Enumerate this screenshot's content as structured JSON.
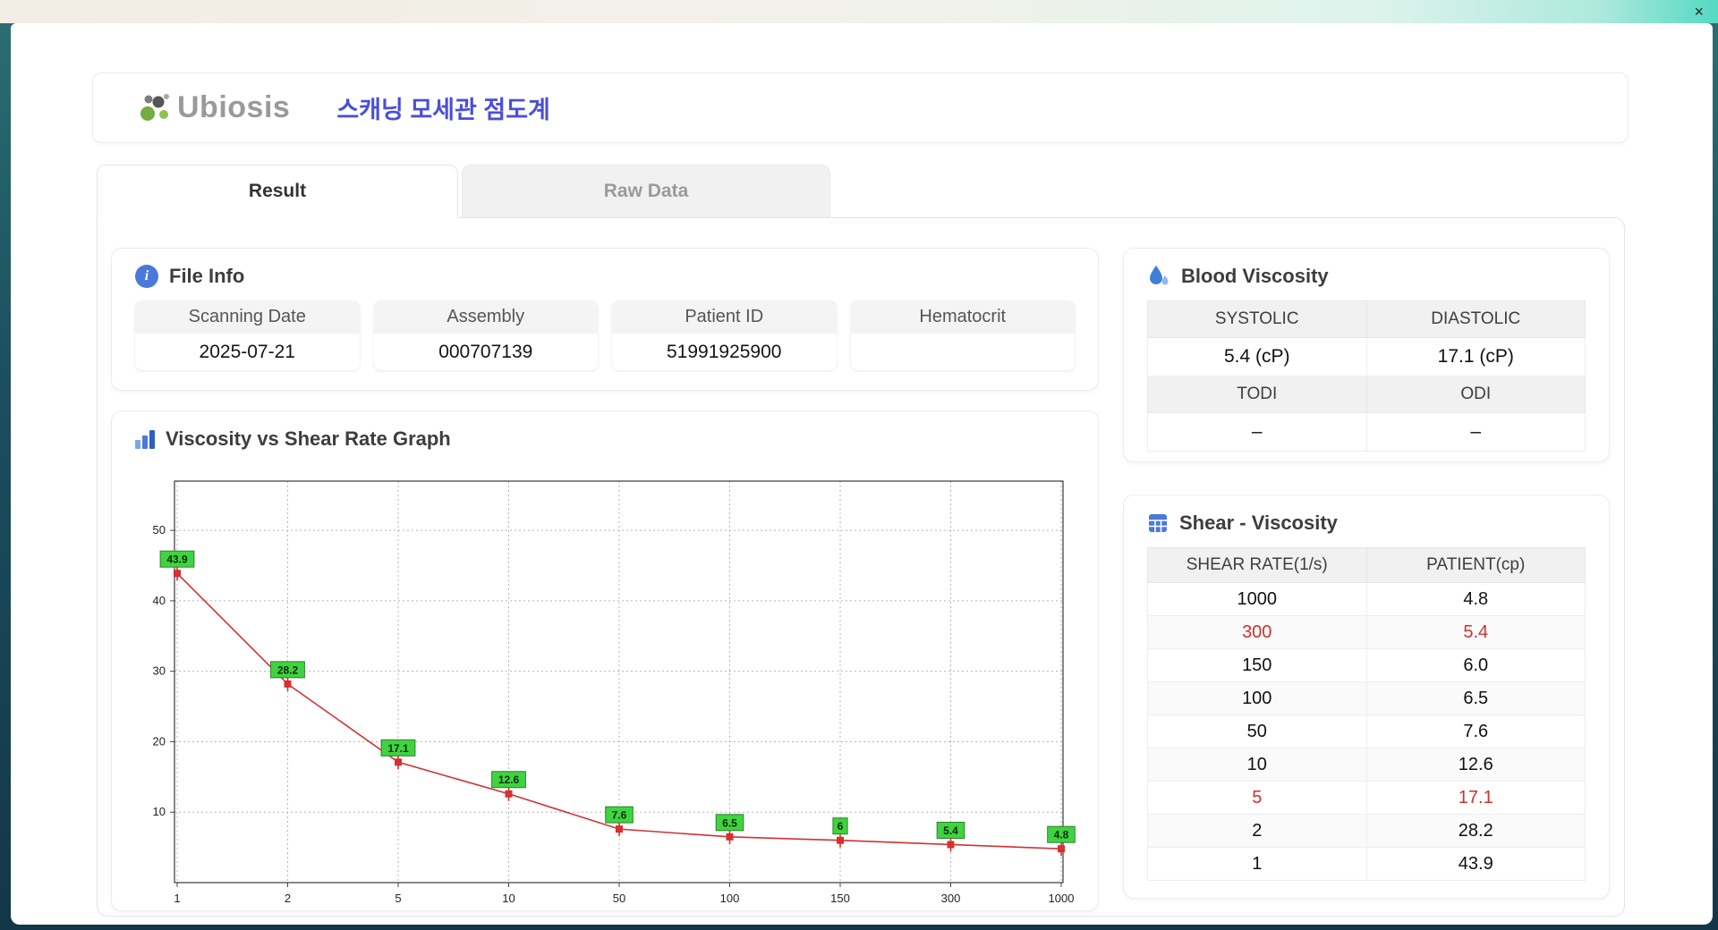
{
  "window": {
    "close_label": "×"
  },
  "header": {
    "brand": "Ubiosis",
    "title": "스캐닝 모세관 점도계"
  },
  "tabs": [
    {
      "label": "Result"
    },
    {
      "label": "Raw Data"
    }
  ],
  "file_info": {
    "section_title": "File Info",
    "fields": [
      {
        "label": "Scanning Date",
        "value": "2025-07-21"
      },
      {
        "label": "Assembly",
        "value": "000707139"
      },
      {
        "label": "Patient ID",
        "value": "51991925900"
      },
      {
        "label": "Hematocrit",
        "value": ""
      }
    ]
  },
  "blood_viscosity": {
    "section_title": "Blood Viscosity",
    "row1": {
      "headers": [
        "SYSTOLIC",
        "DIASTOLIC"
      ],
      "values": [
        "5.4 (cP)",
        "17.1 (cP)"
      ]
    },
    "row2": {
      "headers": [
        "TODI",
        "ODI"
      ],
      "values": [
        "–",
        "–"
      ]
    }
  },
  "graph": {
    "section_title": "Viscosity vs Shear Rate Graph"
  },
  "shear_viscosity": {
    "section_title": "Shear - Viscosity",
    "headers": [
      "SHEAR RATE(1/s)",
      "PATIENT(cp)"
    ],
    "rows": [
      {
        "shear": "1000",
        "patient": "4.8",
        "highlight": false
      },
      {
        "shear": "300",
        "patient": "5.4",
        "highlight": true
      },
      {
        "shear": "150",
        "patient": "6.0",
        "highlight": false
      },
      {
        "shear": "100",
        "patient": "6.5",
        "highlight": false
      },
      {
        "shear": "50",
        "patient": "7.6",
        "highlight": false
      },
      {
        "shear": "10",
        "patient": "12.6",
        "highlight": false
      },
      {
        "shear": "5",
        "patient": "17.1",
        "highlight": true
      },
      {
        "shear": "2",
        "patient": "28.2",
        "highlight": false
      },
      {
        "shear": "1",
        "patient": "43.9",
        "highlight": false
      }
    ]
  },
  "chart_data": {
    "type": "line",
    "x": [
      1,
      2,
      5,
      10,
      50,
      100,
      150,
      300,
      1000
    ],
    "values": [
      43.9,
      28.2,
      17.1,
      12.6,
      7.6,
      6.5,
      6.0,
      5.4,
      4.8
    ],
    "point_labels": [
      "43.9",
      "28.2",
      "17.1",
      "12.6",
      "7.6",
      "6.5",
      "6",
      "5.4",
      "4.8"
    ],
    "title": "Viscosity vs Shear Rate Graph",
    "xlabel": "",
    "ylabel": "",
    "ylim": [
      0,
      57
    ],
    "yticks": [
      10,
      20,
      30,
      40,
      50
    ],
    "x_scale": "categorical",
    "grid": true,
    "legend": "none",
    "line_color": "#cf3333",
    "marker_color": "#d63030",
    "point_label_bg": "#3fd43f"
  },
  "colors": {
    "accent_blue": "#4a4fd8",
    "icon_blue": "#4a79d9",
    "highlight_red": "#d03030",
    "logo_green": "#74ac40",
    "logo_gray": "#9a9a9a"
  },
  "icons": {
    "info_glyph": "i",
    "file_info": "info-icon",
    "blood_viscosity": "droplet-icon",
    "graph": "bar-chart-icon",
    "shear_viscosity": "calculator-icon",
    "close": "close-icon"
  }
}
